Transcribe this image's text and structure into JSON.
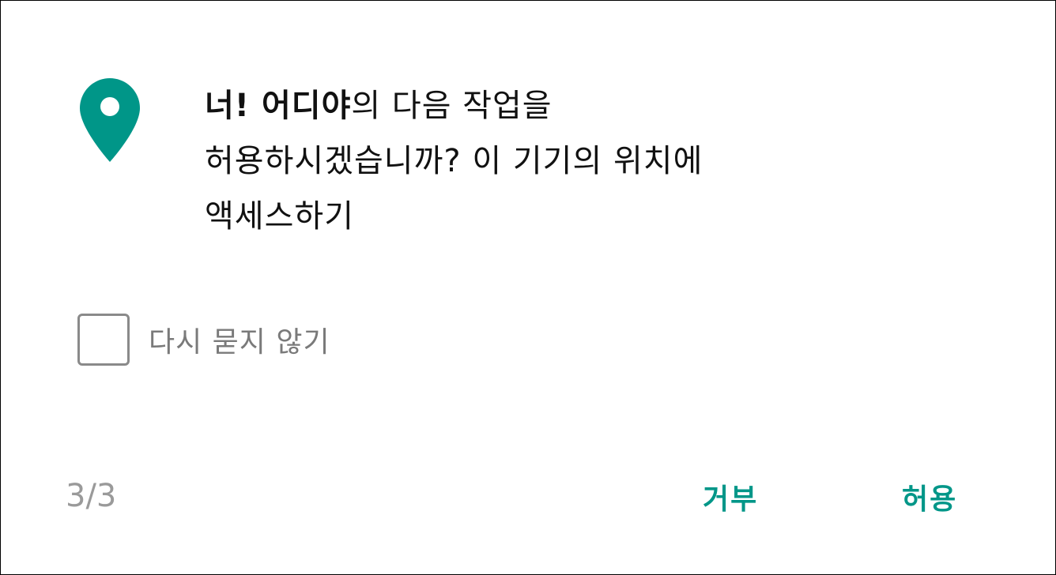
{
  "dialog": {
    "accent_color": "#009688",
    "icon": "location-pin-icon",
    "message": {
      "app_name": "너! 어디야",
      "rest_line1": "의 다음 작업을",
      "line2": "허용하시겠습니까? 이 기기의 위치에",
      "line3": "액세스하기"
    },
    "checkbox": {
      "label": "다시 묻지 않기",
      "checked": false
    },
    "page_counter": "3/3",
    "buttons": {
      "deny_label": "거부",
      "allow_label": "허용"
    }
  }
}
